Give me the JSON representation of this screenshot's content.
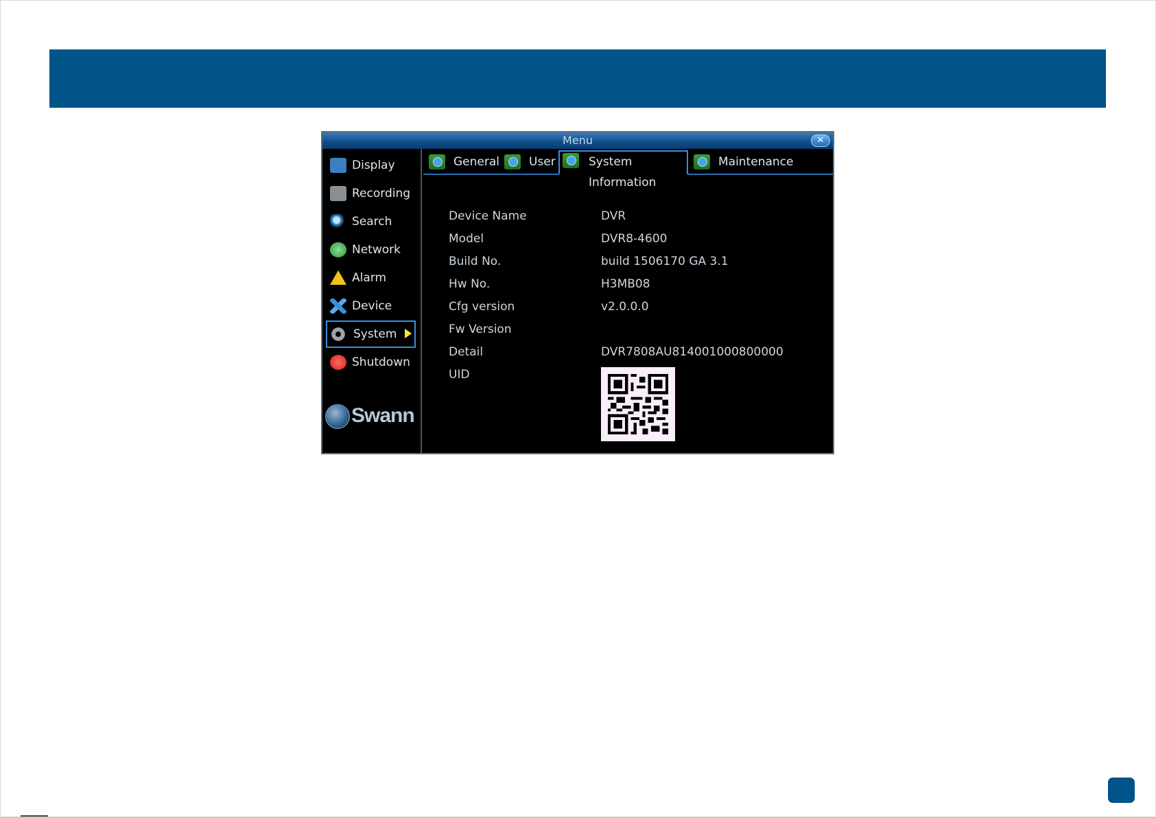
{
  "window": {
    "title": "Menu",
    "close_glyph": "✕"
  },
  "sidebar": {
    "items": [
      {
        "label": "Display",
        "icon": "display-icon",
        "color": "#3a7fc4"
      },
      {
        "label": "Recording",
        "icon": "recording-icon",
        "color": "#8a8f96"
      },
      {
        "label": "Search",
        "icon": "search-icon",
        "color": "#3f9ae0"
      },
      {
        "label": "Network",
        "icon": "network-icon",
        "color": "#4fb35c"
      },
      {
        "label": "Alarm",
        "icon": "alarm-icon",
        "color": "#f2c218"
      },
      {
        "label": "Device",
        "icon": "device-icon",
        "color": "#3a8ee0"
      },
      {
        "label": "System",
        "icon": "gear-icon",
        "color": "#9aa2aa",
        "active": true
      },
      {
        "label": "Shutdown",
        "icon": "power-icon",
        "color": "#e33a32"
      }
    ],
    "logo_text": "Swann"
  },
  "tabs": [
    {
      "label": "General",
      "active": false
    },
    {
      "label": "User",
      "active": false
    },
    {
      "label": "System Information",
      "active": true
    },
    {
      "label": "Maintenance",
      "active": false
    }
  ],
  "info": {
    "rows": [
      {
        "label": "Device Name",
        "value": "DVR"
      },
      {
        "label": "Model",
        "value": "DVR8-4600"
      },
      {
        "label": "Build No.",
        "value": "build 1506170 GA 3.1"
      },
      {
        "label": "Hw No.",
        "value": "H3MB08"
      },
      {
        "label": "Cfg version",
        "value": "v2.0.0.0"
      },
      {
        "label": "Fw Version",
        "value": ""
      },
      {
        "label": "Detail",
        "value": "DVR7808AU814001000800000"
      },
      {
        "label": "UID",
        "value": ""
      }
    ]
  },
  "colors": {
    "header_band": "#00548a",
    "accent_border": "#3c8ee0",
    "active_arrow": "#f5e83a"
  }
}
